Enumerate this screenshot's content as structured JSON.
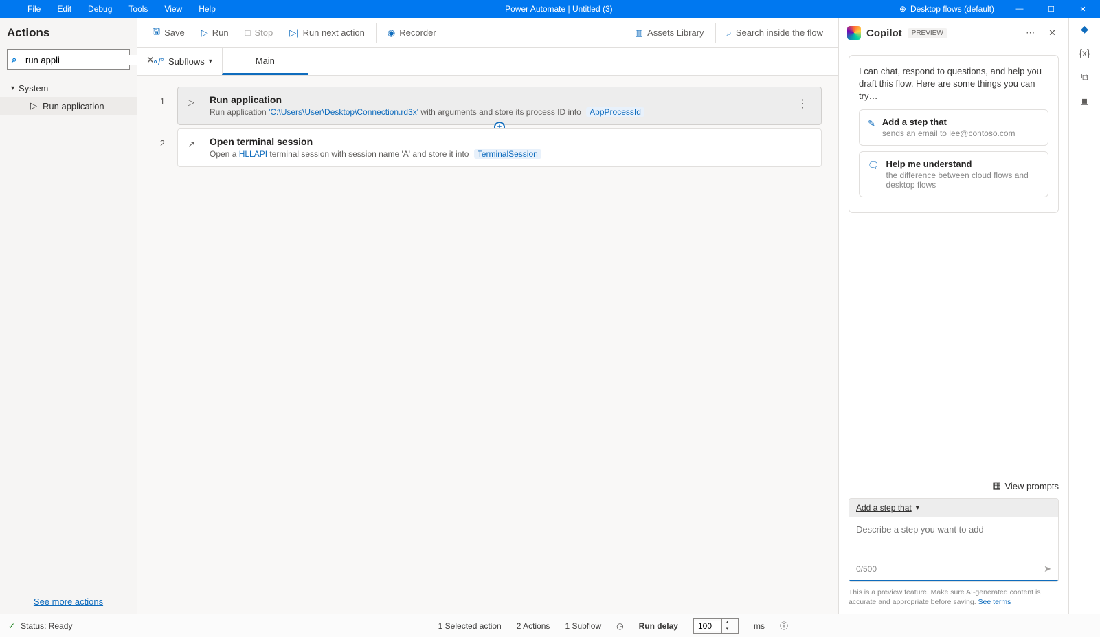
{
  "titlebar": {
    "menus": [
      "File",
      "Edit",
      "Debug",
      "Tools",
      "View",
      "Help"
    ],
    "title": "Power Automate | Untitled (3)",
    "env": "Desktop flows (default)"
  },
  "left": {
    "title": "Actions",
    "search_value": "run appli",
    "tree_group": "System",
    "tree_leaf": "Run application",
    "see_more": "See more actions"
  },
  "toolbar": {
    "save": "Save",
    "run": "Run",
    "stop": "Stop",
    "run_next": "Run next action",
    "recorder": "Recorder",
    "assets": "Assets Library",
    "search": "Search inside the flow"
  },
  "tabs": {
    "subflows": "Subflows",
    "main": "Main"
  },
  "steps": [
    {
      "n": "1",
      "title": "Run application",
      "desc_prefix": "Run application ",
      "path": "'C:\\Users\\User\\Desktop\\Connection.rd3x'",
      "desc_mid": " with arguments  and store its process ID into ",
      "var": "AppProcessId",
      "selected": true,
      "icon": "play"
    },
    {
      "n": "2",
      "title": "Open terminal session",
      "desc_prefix": "Open a ",
      "path": "HLLAPI",
      "desc_mid": " terminal session with session name 'A' and store it into ",
      "var": "TerminalSession",
      "selected": false,
      "icon": "arrow"
    }
  ],
  "copilot": {
    "title": "Copilot",
    "badge": "PREVIEW",
    "intro": "I can chat, respond to questions, and help you draft this flow. Here are some things you can try…",
    "sugg1_title": "Add a step that",
    "sugg1_desc": "sends an email to lee@contoso.com",
    "sugg2_title": "Help me understand",
    "sugg2_desc": "the difference between cloud flows and desktop flows",
    "view_prompts": "View prompts",
    "input_header": "Add a step that",
    "placeholder": "Describe a step you want to add",
    "count": "0/500",
    "disclaimer_a": "This is a preview feature. Make sure AI-generated content is accurate and appropriate before saving. ",
    "disclaimer_link": "See terms"
  },
  "status": {
    "ready": "Status: Ready",
    "selected": "1 Selected action",
    "actions": "2 Actions",
    "subflows": "1 Subflow",
    "run_delay_label": "Run delay",
    "run_delay_value": "100",
    "ms": "ms"
  }
}
